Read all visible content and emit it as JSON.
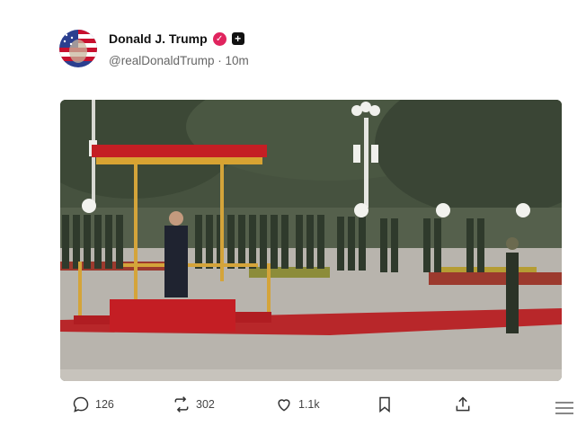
{
  "post": {
    "author_name": "Donald J. Trump",
    "handle": "@realDonaldTrump",
    "separator": "·",
    "time": "10m",
    "verified_icon": "verified-badge-icon",
    "extra_icon": "plus-square-icon"
  },
  "actions": {
    "replies": "126",
    "reposts": "302",
    "likes": "1.1k"
  },
  "colors": {
    "verified": "#e0245e",
    "carpet": "#b8272a",
    "podium": "#c41e24"
  }
}
